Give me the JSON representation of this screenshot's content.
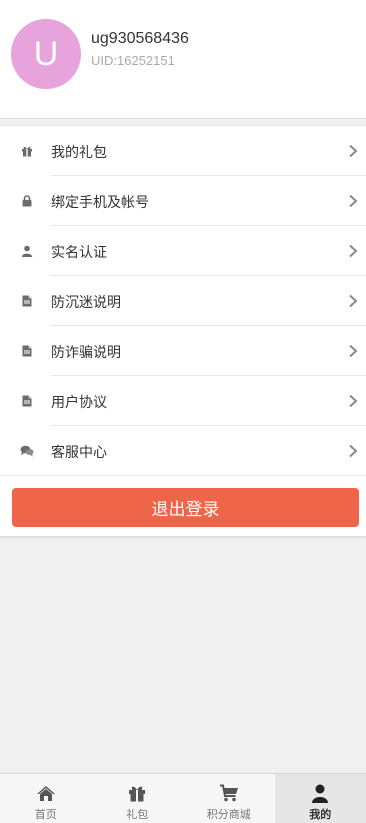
{
  "profile": {
    "avatar_letter": "U",
    "avatar_color": "#e6a3dc",
    "username": "ug930568436",
    "uid": "UID:16252151"
  },
  "menu": {
    "items": [
      {
        "label": "我的礼包",
        "icon": "gift-icon"
      },
      {
        "label": "绑定手机及帐号",
        "icon": "lock-icon"
      },
      {
        "label": "实名认证",
        "icon": "user-icon"
      },
      {
        "label": "防沉迷说明",
        "icon": "document-icon"
      },
      {
        "label": "防诈骗说明",
        "icon": "document-icon"
      },
      {
        "label": "用户协议",
        "icon": "document-icon"
      },
      {
        "label": "客服中心",
        "icon": "chat-icon"
      }
    ]
  },
  "logout": {
    "label": "退出登录",
    "color": "#ef654a"
  },
  "tabbar": {
    "tabs": [
      {
        "label": "首页",
        "icon": "home-icon"
      },
      {
        "label": "礼包",
        "icon": "gift-icon"
      },
      {
        "label": "积分商城",
        "icon": "cart-icon"
      },
      {
        "label": "我的",
        "icon": "user-icon",
        "active": true
      }
    ]
  }
}
